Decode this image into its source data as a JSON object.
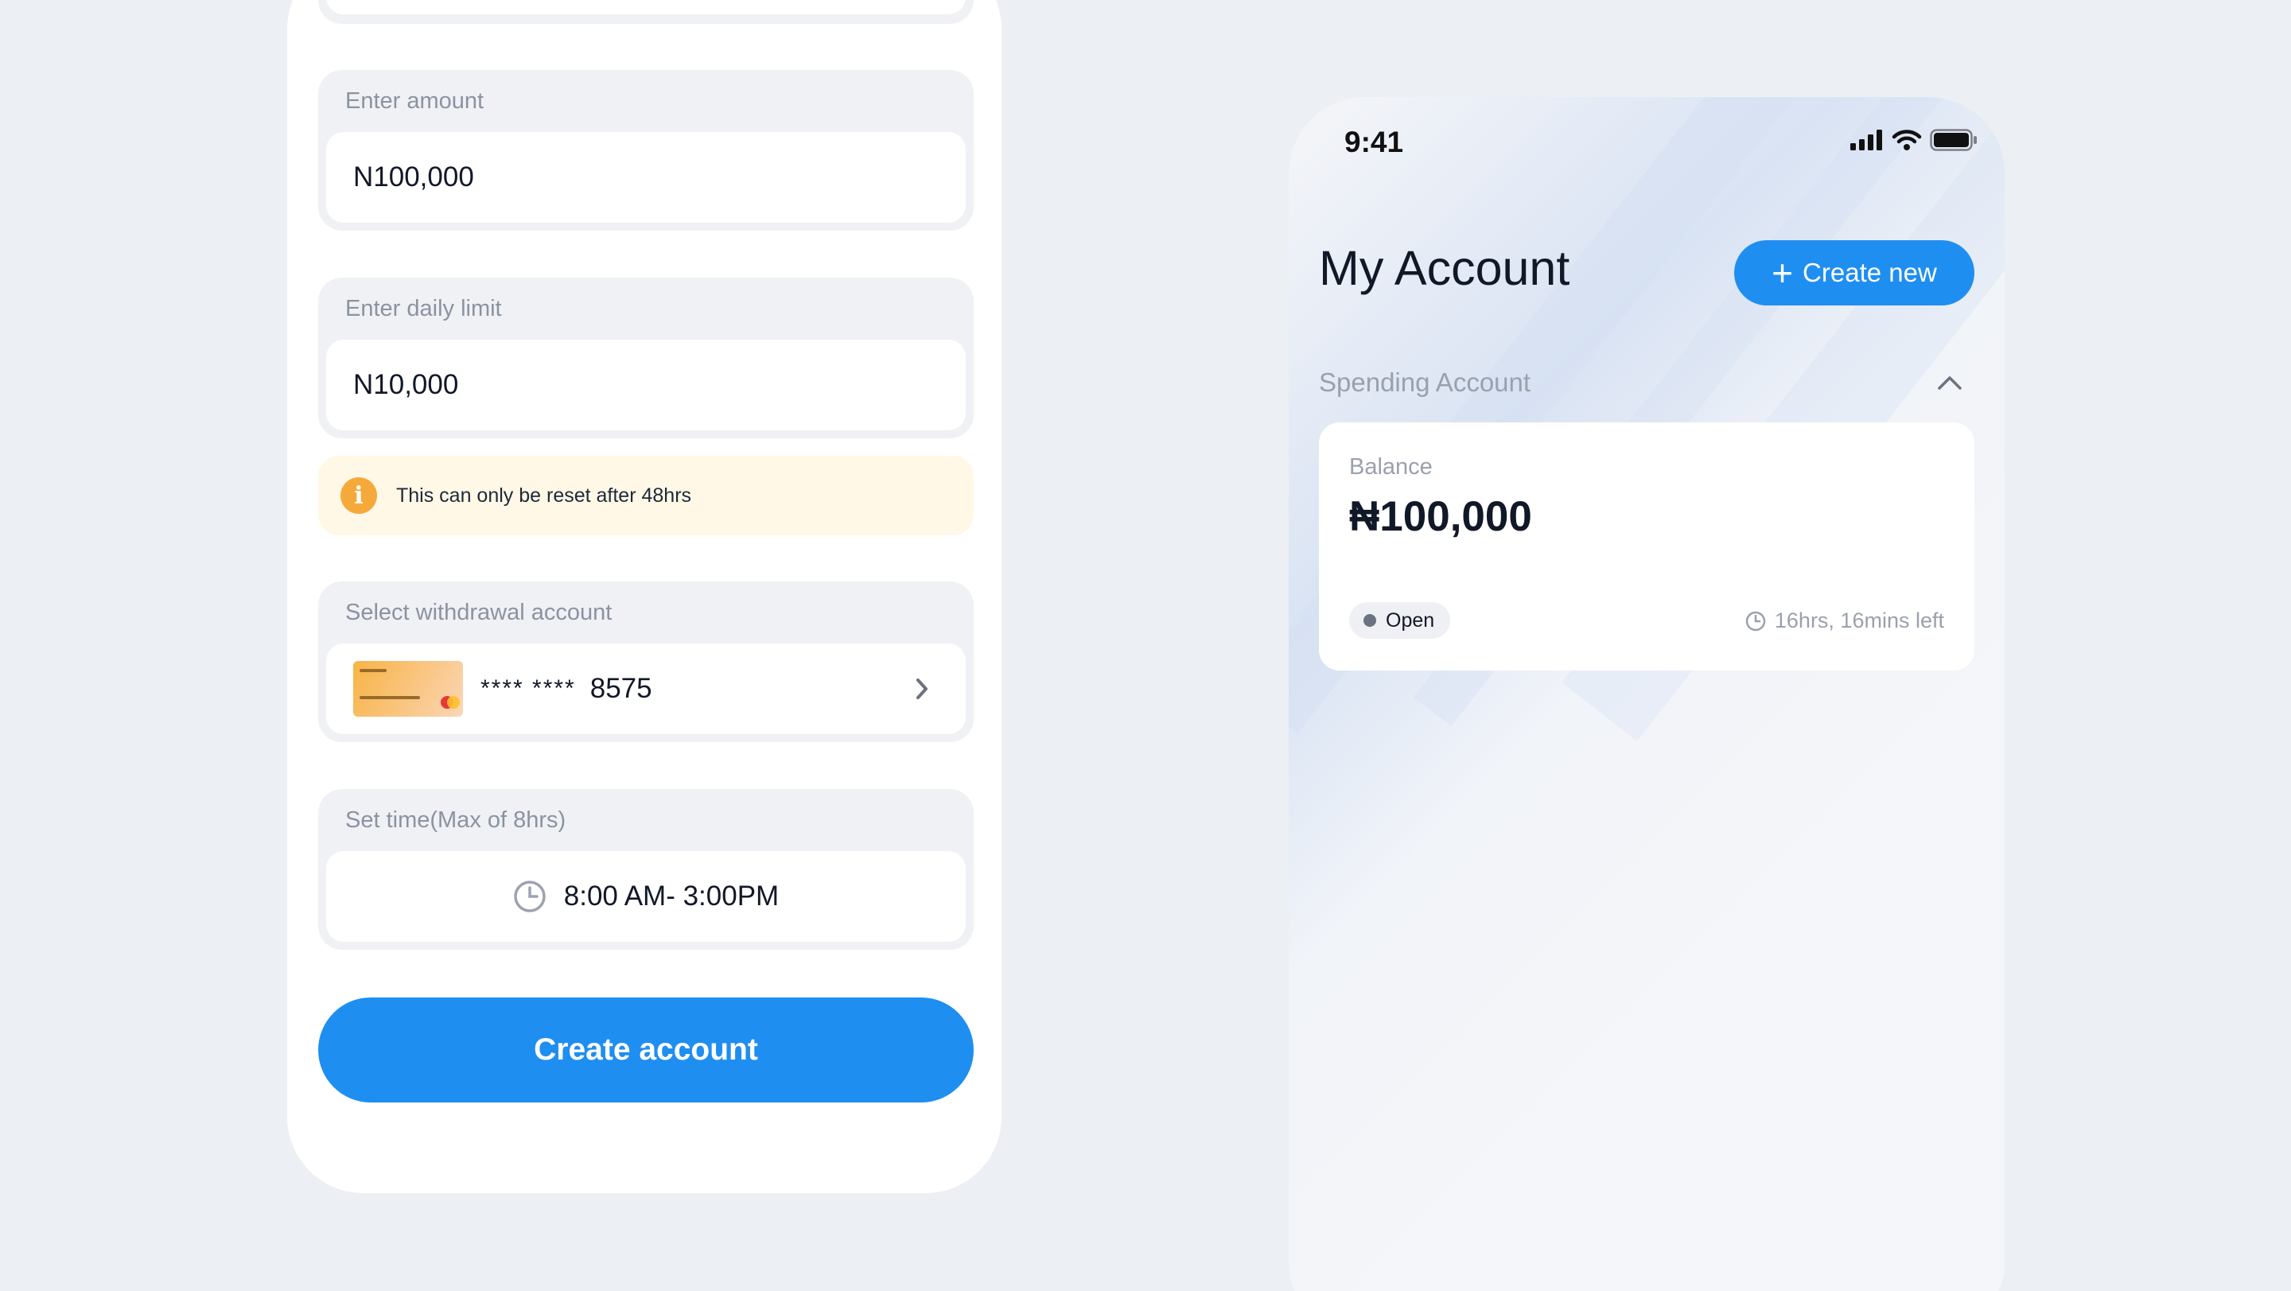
{
  "left_screen": {
    "amount": {
      "label": "Enter amount",
      "value": "N100,000"
    },
    "daily_limit": {
      "label": "Enter daily limit",
      "value": "N10,000"
    },
    "notice": {
      "text": "This can only be reset after 48hrs",
      "icon": "info-icon"
    },
    "withdrawal": {
      "label": "Select withdrawal account",
      "masked": "**** ****",
      "last4": "8575"
    },
    "time": {
      "label": "Set time(Max of 8hrs)",
      "value": "8:00 AM- 3:00PM"
    },
    "submit_label": "Create account"
  },
  "right_screen": {
    "status_time": "9:41",
    "title": "My Account",
    "create_new_label": "Create new",
    "section_label": "Spending Account",
    "balance": {
      "label": "Balance",
      "value": "₦100,000",
      "status": "Open",
      "time_left": "16hrs, 16mins left"
    }
  },
  "colors": {
    "background": "#eceff3",
    "primary": "#1f8ef1",
    "notice_bg": "#fff8e7",
    "notice_icon": "#f6a93b"
  }
}
